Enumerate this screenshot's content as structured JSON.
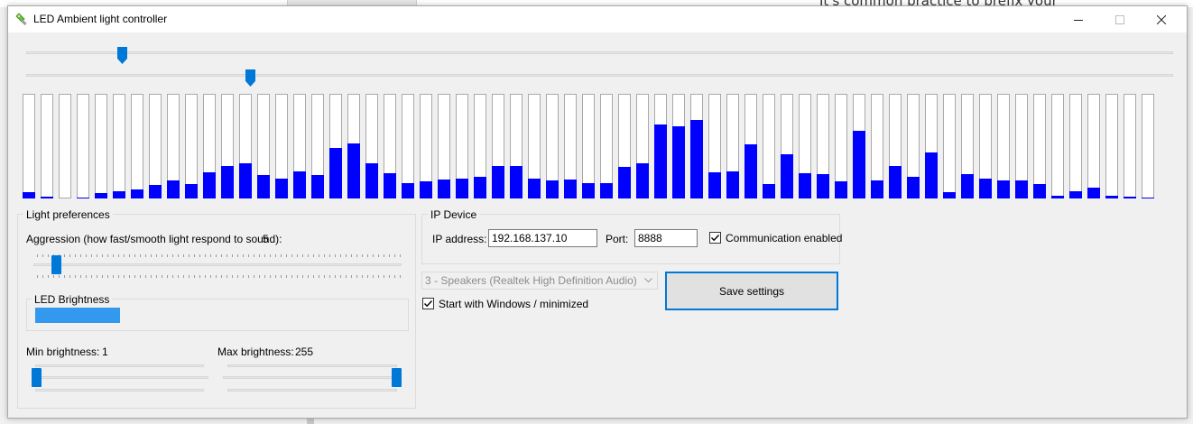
{
  "background": {
    "text": "It's common practice to prefix your"
  },
  "window": {
    "title": "LED Ambient light controller",
    "icon": "led-bulb-icon",
    "min_icon": "minimize-icon",
    "max_icon": "maximize-icon",
    "close_icon": "close-icon"
  },
  "colors": {
    "accent": "#0078d7",
    "spectrum_bar": "#0000ff",
    "brightness": "#3399ee"
  },
  "top_sliders": [
    {
      "level": 0.08
    },
    {
      "level": 0.193
    }
  ],
  "spectrum_levels": [
    6,
    2,
    0,
    1,
    5,
    7,
    9,
    13,
    17,
    14,
    25,
    31,
    34,
    22,
    19,
    26,
    22,
    48,
    53,
    34,
    24,
    15,
    16,
    18,
    19,
    21,
    31,
    31,
    19,
    17,
    18,
    15,
    15,
    30,
    34,
    71,
    69,
    75,
    25,
    26,
    52,
    14,
    42,
    24,
    23,
    16,
    65,
    17,
    31,
    21,
    44,
    6,
    23,
    19,
    17,
    17,
    14,
    3,
    7,
    10,
    3,
    2,
    1
  ],
  "light_preferences": {
    "legend": "Light preferences",
    "aggression_label": "Aggression (how fast/smooth light respond to sound):",
    "aggression_value": "5",
    "aggression_level": 0.04,
    "led_brightness": {
      "legend": "LED Brightness",
      "level": 0.23
    },
    "min_label": "Min brightness:",
    "min_value": "1",
    "min_level": 0.0,
    "max_label": "Max brightness:",
    "max_value": "255",
    "max_level": 1.0
  },
  "ip_device": {
    "legend": "IP Device",
    "ip_label": "IP address:",
    "ip_value": "192.168.137.10",
    "port_label": "Port:",
    "port_value": "8888",
    "comm_label": "Communication enabled",
    "comm_checked": true
  },
  "audio": {
    "device": "3 - Speakers (Realtek High Definition Audio)",
    "startup_label": "Start with Windows / minimized",
    "startup_checked": true
  },
  "save_label": "Save settings"
}
